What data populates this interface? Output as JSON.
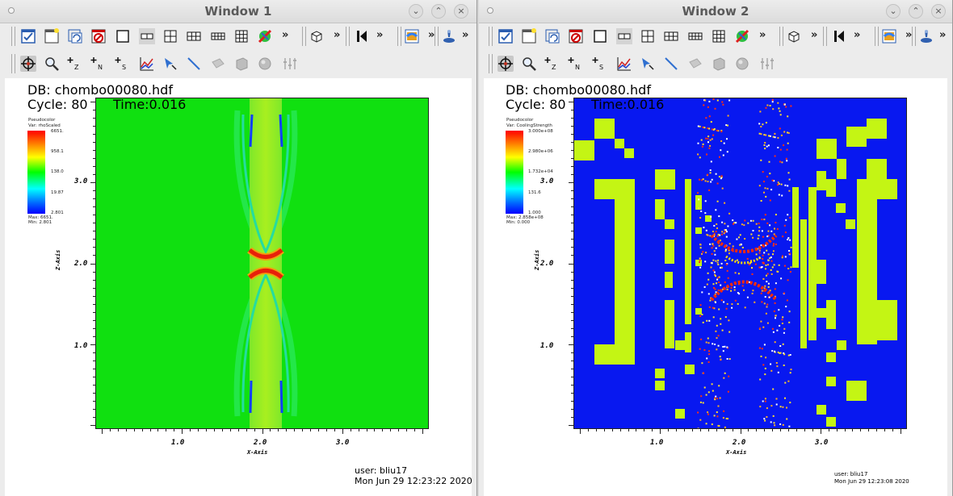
{
  "window1": {
    "title": "Window 1",
    "db": "DB: chombo00080.hdf",
    "cycle": "Cycle: 80",
    "time": "Time:0.016",
    "legend": {
      "plot_type": "Pseudocolor",
      "var": "Var: rhoScaled",
      "ticks": [
        "6651.",
        "958.1",
        "138.0",
        "19.87",
        "2.801"
      ],
      "max": "Max: 6651.",
      "min": "Min: 2.801"
    },
    "y_ticks": [
      "3.0",
      "2.0",
      "1.0"
    ],
    "x_ticks": [
      "1.0",
      "2.0",
      "3.0"
    ],
    "x_label": "X-Axis",
    "y_label": "Z-Axis",
    "user": "user: bliu17",
    "date": "Mon Jun 29 12:23:22 2020"
  },
  "window2": {
    "title": "Window 2",
    "db": "DB: chombo00080.hdf",
    "cycle": "Cycle: 80",
    "time": "Time:0.016",
    "legend": {
      "plot_type": "Pseudocolor",
      "var": "Var: CoolingStrength",
      "ticks": [
        "3.000e+08",
        "2.980e+06",
        "1.732e+04",
        "131.6",
        "1.000"
      ],
      "max": "Max: 2.858e+08",
      "min": "Min: 0.000"
    },
    "y_ticks": [
      "3.0",
      "2.0",
      "1.0"
    ],
    "x_ticks": [
      "1.0",
      "2.0",
      "3.0"
    ],
    "x_label": "X-Axis",
    "y_label": "Z-Axis",
    "user": "user: bliu17",
    "date": "Mon Jun 29 12:23:08 2020"
  },
  "colors": {
    "field_green": "#10e010",
    "field_blue": "#0818f0",
    "block_yellow": "#c4f514",
    "ridge_red": "#e8200a"
  },
  "toolbar1_icons": [
    "active-window-icon",
    "new-window-icon",
    "copy-window-icon",
    "delete-window-icon",
    "layout-1x1-icon",
    "layout-1x2-icon",
    "layout-2x2-icon",
    "layout-2x3-icon",
    "layout-2x4-icon",
    "layout-3x3-icon",
    "lock-view-icon",
    "more-icon",
    "view-3d-icon",
    "more-icon",
    "animation-prev-icon",
    "more-icon",
    "plot-icon",
    "more-icon",
    "pick-icon",
    "more-icon"
  ],
  "toolbar2_icons": [
    "navigate-icon",
    "zoom-icon",
    "zone-pick-icon",
    "node-pick-icon",
    "spreadsheet-pick-icon",
    "lineout-icon",
    "point-tool-icon",
    "line-tool-icon",
    "plane-tool-icon",
    "box-tool-icon",
    "sphere-tool-icon",
    "axis-restrict-icon"
  ]
}
